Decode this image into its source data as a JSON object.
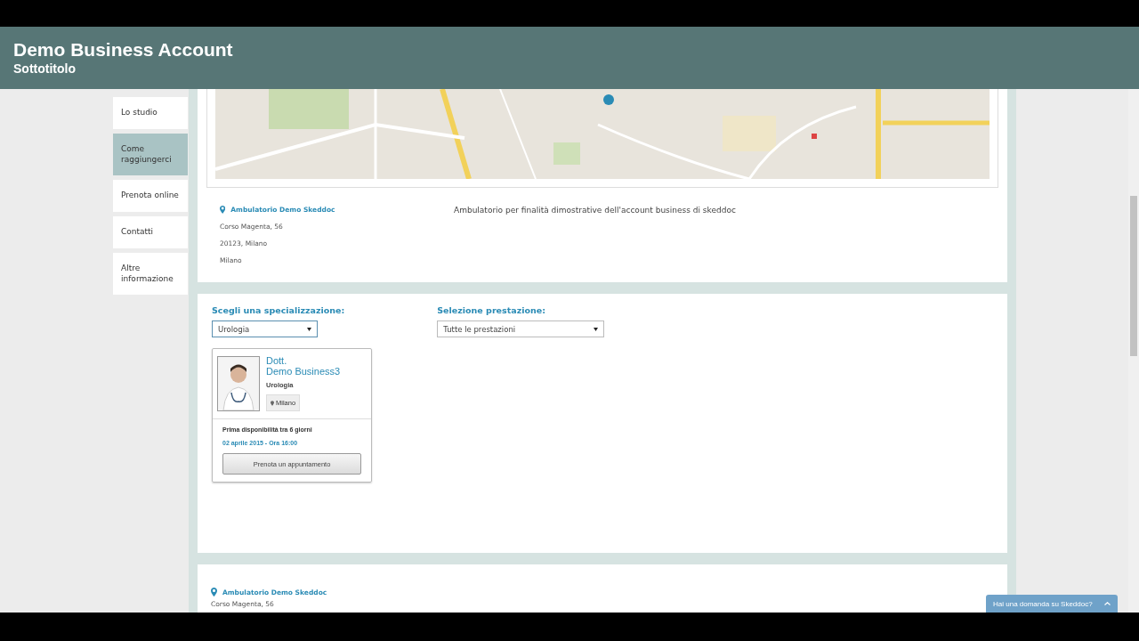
{
  "header": {
    "title": "Demo Business Account",
    "subtitle": "Sottotitolo"
  },
  "sidebar": {
    "items": [
      {
        "label": "Lo studio",
        "selected": false
      },
      {
        "label": "Come raggiungerci",
        "selected": true
      },
      {
        "label": "Prenota online",
        "selected": false
      },
      {
        "label": "Contatti",
        "selected": false
      },
      {
        "label": "Altre informazione",
        "selected": false
      }
    ]
  },
  "location": {
    "name": "Ambulatorio Demo Skeddoc",
    "address": [
      "Corso Magenta, 56",
      "20123, Milano",
      "Milano"
    ],
    "description": "Ambulatorio per finalità dimostrative dell'account business di skeddoc"
  },
  "booking": {
    "filters": [
      {
        "label": "Scegli una specializzazione:",
        "value": "Urologia"
      },
      {
        "label": "Selezione prestazione:",
        "value": "Tutte le prestazioni"
      }
    ],
    "doctor": {
      "title": "Dott.",
      "name": "Demo Business3",
      "specialty": "Urologia",
      "city": "Milano",
      "availability": "Prima disponibilità tra 6 giorni",
      "slot": "02 aprile 2015 - Ora 16:00",
      "button": "Prenota un appuntamento"
    }
  },
  "next_location": {
    "name": "Ambulatorio Demo Skeddoc",
    "address": "Corso Magenta, 56"
  },
  "chat": {
    "label": "Hai una domanda su Skeddoc?"
  }
}
